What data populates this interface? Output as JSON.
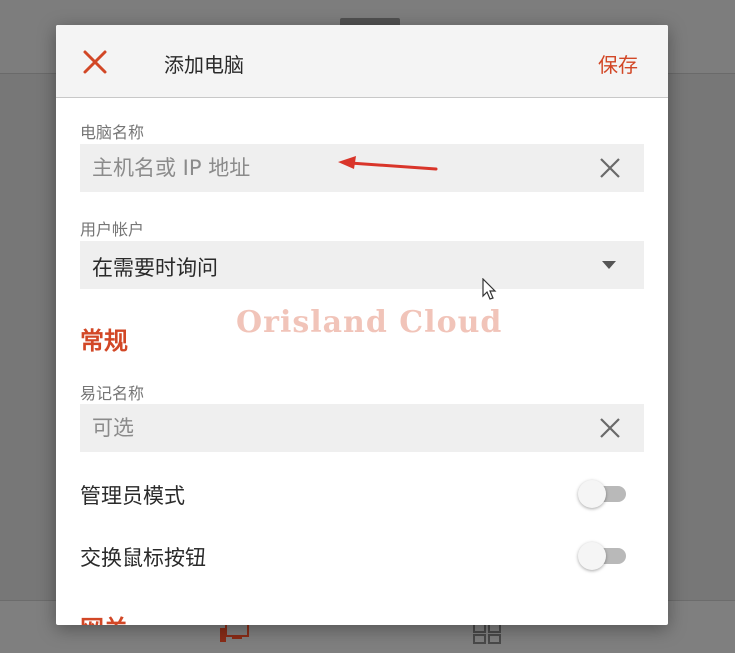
{
  "dialog": {
    "title": "添加电脑",
    "save_label": "保存",
    "close_icon": "close-icon"
  },
  "computer_name": {
    "label": "电脑名称",
    "placeholder": "主机名或 IP 地址",
    "value": ""
  },
  "user_account": {
    "label": "用户帐户",
    "selected": "在需要时询问"
  },
  "general_section": {
    "title": "常规",
    "friendly_name": {
      "label": "易记名称",
      "placeholder": "可选",
      "value": ""
    },
    "admin_mode": {
      "label": "管理员模式",
      "on": false
    },
    "swap_mouse_buttons": {
      "label": "交换鼠标按钮",
      "on": false
    }
  },
  "gateway_section": {
    "title": "网关"
  },
  "watermark": "Orisland Cloud",
  "colors": {
    "accent": "#d24726",
    "field_bg": "#efefef",
    "header_bg": "#f4f4f4",
    "overlay": "#7a7a7a"
  }
}
